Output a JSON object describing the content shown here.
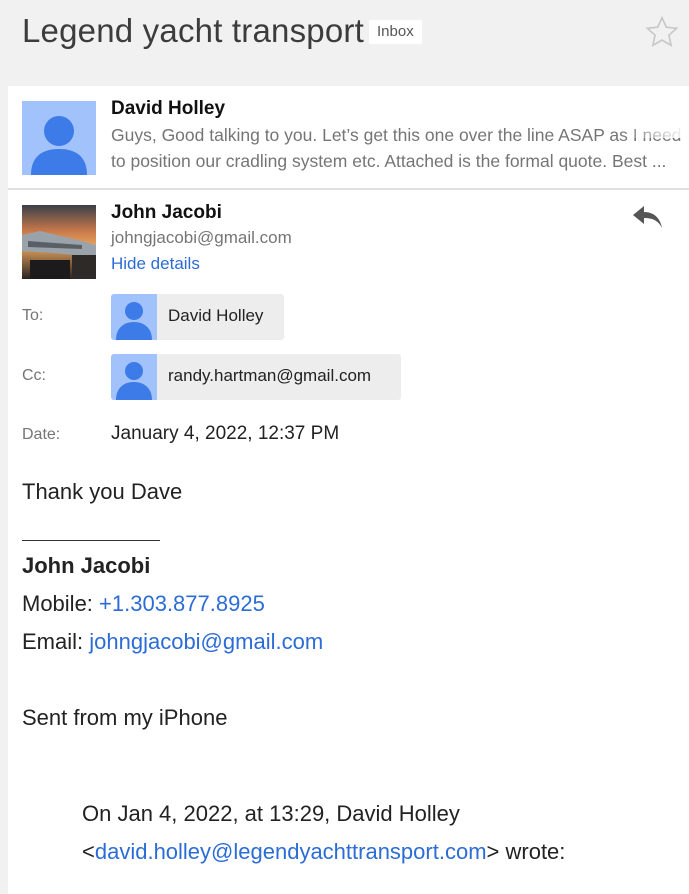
{
  "thread": {
    "subject": "Legend yacht transport",
    "label": "Inbox"
  },
  "collapsed_message": {
    "sender": "David Holley",
    "snippet": "Guys, Good talking to you. Let’s get this one over the line ASAP as I need to position our cradling system etc. Attached is the formal quote. Best ..."
  },
  "message": {
    "sender_name": "John Jacobi",
    "sender_email": "johngjacobi@gmail.com",
    "hide_details": "Hide details",
    "to_label": "To:",
    "to_value": "David Holley",
    "cc_label": "Cc:",
    "cc_value": "randy.hartman@gmail.com",
    "date_label": "Date:",
    "date_value": "January 4, 2022, 12:37 PM",
    "body": {
      "greeting": "Thank you Dave",
      "sig_name": "John Jacobi",
      "mobile_label": "Mobile: ",
      "mobile_value": "+1.303.877.8925",
      "email_label": "Email: ",
      "email_value": "johngjacobi@gmail.com",
      "sent_from": "Sent from my iPhone",
      "quote_header_1": "On Jan 4, 2022, at 13:29, David Holley",
      "quote_open": "<",
      "quote_email": "david.holley@legendyachttransport.com",
      "quote_close": "> wrote:"
    }
  },
  "icons": {
    "star": "star-icon",
    "reply": "reply-icon",
    "avatar": "person-icon"
  },
  "colors": {
    "link": "#2b6cd6",
    "avatar_bg": "#a1c2fa",
    "avatar_fg": "#3d7be8"
  }
}
